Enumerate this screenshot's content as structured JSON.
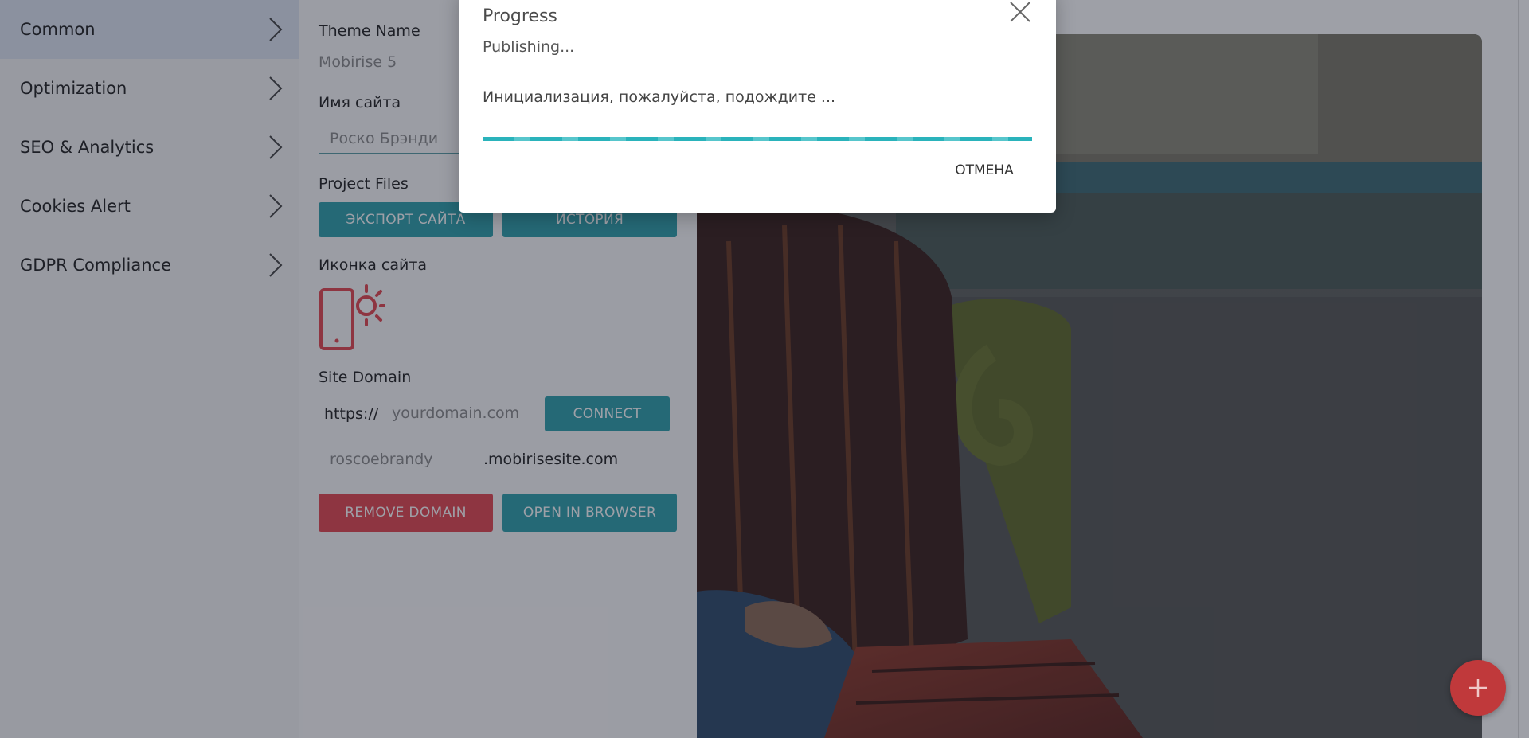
{
  "sidebar": {
    "items": [
      {
        "label": "Common"
      },
      {
        "label": "Optimization"
      },
      {
        "label": "SEO & Analytics"
      },
      {
        "label": "Cookies Alert"
      },
      {
        "label": "GDPR Compliance"
      }
    ]
  },
  "settings": {
    "theme_name_label": "Theme Name",
    "theme_name_value": "Mobirise 5",
    "site_name_label": "Имя сайта",
    "site_name_value": "Роско Брэнди",
    "project_files_label": "Project Files",
    "export_button": "ЭКСПОРТ САЙТА",
    "history_button": "ИСТОРИЯ",
    "site_icon_label": "Иконка сайта",
    "site_icon": "phone-sun-icon",
    "site_domain_label": "Site Domain",
    "https_prefix": "https://",
    "domain_placeholder": "yourdomain.com",
    "connect_button": "CONNECT",
    "subdomain_value": "roscoebrandy",
    "subdomain_suffix": ".mobirisesite.com",
    "remove_domain_button": "REMOVE DOMAIN",
    "open_in_browser_button": "OPEN IN BROWSER"
  },
  "modal": {
    "title": "Progress",
    "status": "Publishing...",
    "message": "Инициализация, пожалуйста, подождите ...",
    "cancel_button": "ОТМЕНА",
    "progress": 1.0
  },
  "fab": {
    "icon": "plus-icon"
  },
  "colors": {
    "accent_teal": "#2fa0ab",
    "danger_red": "#e34850",
    "fab_red": "#c0393b",
    "icon_red": "#e34850"
  }
}
